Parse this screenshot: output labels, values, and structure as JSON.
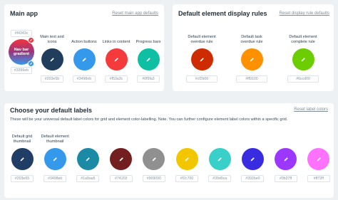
{
  "main_app": {
    "title": "Main app",
    "reset_label": "Reset main app defaults",
    "navbar": {
      "label": "Nav bar gradient",
      "hex_top": "#f4343c",
      "hex_bottom": "#3399eb"
    },
    "items": [
      {
        "label": "Main text and icons",
        "hex": "#203e5b",
        "color": "#203e5b"
      },
      {
        "label": "Action buttons",
        "hex": "#3498eb",
        "color": "#3498eb"
      },
      {
        "label": "Links in content",
        "hex": "#f53a3c",
        "color": "#f53a3c"
      },
      {
        "label": "Progress bars",
        "hex": "#0f9fa3",
        "color": "#0ebfa3"
      }
    ]
  },
  "display_rules": {
    "title": "Default element display rules",
    "reset_label": "Reset display rule defaults",
    "items": [
      {
        "label": "Default element overdue rule",
        "hex": "#cf2b00",
        "color": "#cf2b00"
      },
      {
        "label": "Default task overdue rule",
        "hex": "#ff9100",
        "color": "#ff9100"
      },
      {
        "label": "Default element complete rule",
        "hex": "#6ccd00",
        "color": "#6ccd00"
      }
    ]
  },
  "default_labels": {
    "title": "Choose your default labels",
    "reset_label": "Reset label colors",
    "description": "These will be your universal default label colors for grid and element color-labelling. Note. You can further configure element label colors within a specific grid.",
    "items": [
      {
        "label": "Default grid thumbnail",
        "hex": "#203e65",
        "color": "#203e65"
      },
      {
        "label": "Default element thumbnail",
        "hex": "#3498eb",
        "color": "#3498eb"
      },
      {
        "label": "",
        "hex": "#1a9aa5",
        "color": "#1a8aa5"
      },
      {
        "label": "",
        "hex": "#741f1f",
        "color": "#741f1f"
      },
      {
        "label": "",
        "hex": "#909090",
        "color": "#909090"
      },
      {
        "label": "",
        "hex": "#f2c700",
        "color": "#f2c700"
      },
      {
        "label": "",
        "hex": "#39d0ca",
        "color": "#39d0ca"
      },
      {
        "label": "",
        "hex": "#392be0",
        "color": "#392be0"
      },
      {
        "label": "",
        "hex": "#9b37ff",
        "color": "#9b37ff"
      },
      {
        "label": "",
        "hex": "#ff72ff",
        "color": "#ff72ff"
      }
    ]
  }
}
